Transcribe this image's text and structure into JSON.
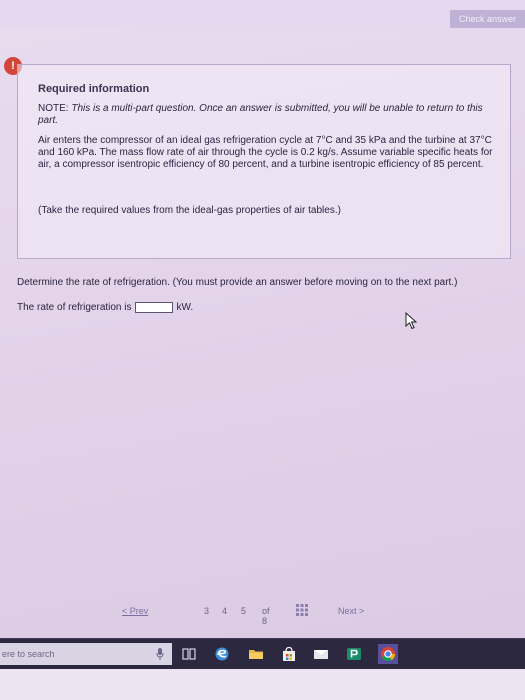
{
  "header": {
    "check_label": "Check answer"
  },
  "info": {
    "badge": "!",
    "title": "Required information",
    "note_label": "NOTE:",
    "note_text": "This is a multi-part question. Once an answer is submitted, you will be unable to return to this part.",
    "problem": "Air enters the compressor of an ideal gas refrigeration cycle at 7°C and 35 kPa and the turbine at 37°C and 160 kPa. The mass flow rate of air through the cycle is 0.2 kg/s. Assume variable specific heats for air, a compressor isentropic efficiency of 80 percent, and a turbine isentropic efficiency of 85 percent.",
    "hint": "(Take the required values from the ideal-gas properties of air tables.)"
  },
  "question": {
    "prompt": "Determine the rate of refrigeration. (You must provide an answer before moving on to the next part.)",
    "answer_prefix": "The rate of refrigeration is",
    "answer_value": "",
    "answer_unit": "kW."
  },
  "pager": {
    "prev_label": "< Prev",
    "pages": [
      "3",
      "4",
      "5"
    ],
    "of_label": "of 8",
    "next_label": "Next >"
  },
  "taskbar": {
    "search_placeholder": "ere to search"
  },
  "colors": {
    "accent": "#7a6fa0",
    "badge": "#d2473c",
    "taskbar": "#2b2840"
  }
}
